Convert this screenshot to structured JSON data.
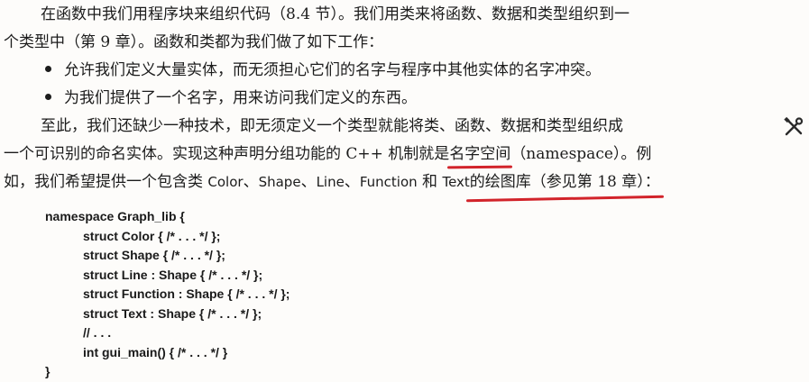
{
  "paragraph1": {
    "line1": "在函数中我们用程序块来组织代码（8.4 节）。我们用类来将函数、数据和类型组织到一",
    "line2": "个类型中（第 9 章）。函数和类都为我们做了如下工作："
  },
  "bullets": [
    "允许我们定义大量实体，而无须担心它们的名字与程序中其他实体的名字冲突。",
    "为我们提供了一个名字，用来访问我们定义的东西。"
  ],
  "paragraph2": {
    "line1": "至此，我们还缺少一种技术，即无须定义一个类型就能将类、函数、数据和类型组织成",
    "line2_a": "一个可识别的命名实体。实现这种声明分组功能的 C++ 机制就是",
    "line2_term": "名字空间",
    "line2_b": "（namespace）。例",
    "line3_a": "如，我们希望提供一个包含类 ",
    "class_names": [
      "Color",
      "Shape",
      "Line",
      "Function",
      "Text"
    ],
    "sep": "、",
    "line3_and": " 和 ",
    "line3_b": " 的绘图库（",
    "line3_ref": "参见第 18 章",
    "line3_c": "）："
  },
  "code_lines": [
    "namespace Graph_lib {",
    "struct Color { /* . . . */ };",
    "struct Shape { /* . . . */ };",
    "struct Line : Shape { /* . . . */ };",
    "struct Function : Shape { /* . . . */ };",
    "struct Text : Shape { /* . . . */ };",
    "// . . .",
    "int gui_main() { /* . . . */ }",
    "}"
  ],
  "colors": {
    "annotation": "#d2232a",
    "text": "#1c1c1c"
  },
  "icons": {
    "margin": "tools-icon"
  }
}
